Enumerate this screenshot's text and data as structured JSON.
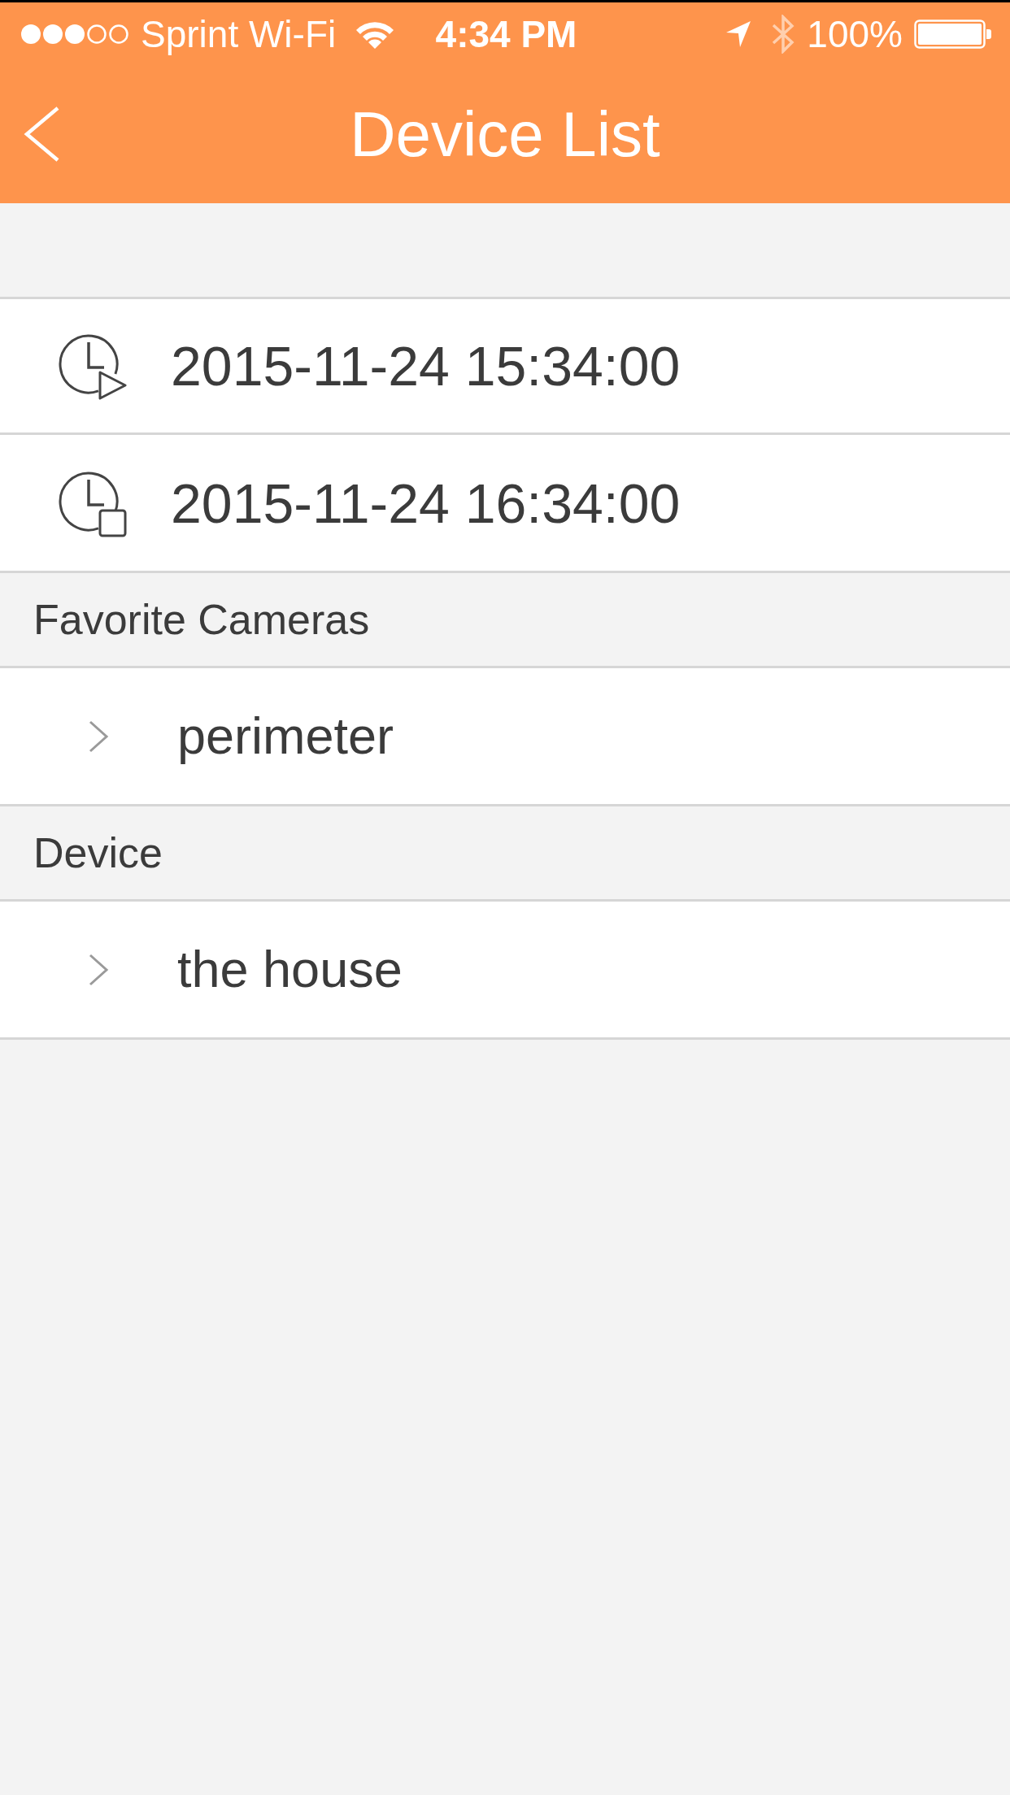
{
  "status_bar": {
    "carrier": "Sprint Wi-Fi",
    "time": "4:34 PM",
    "battery": "100%"
  },
  "nav_bar": {
    "title": "Device List"
  },
  "time_range": [
    {
      "kind": "start",
      "value": "2015-11-24 15:34:00"
    },
    {
      "kind": "end",
      "value": "2015-11-24 16:34:00"
    }
  ],
  "sections": [
    {
      "header": "Favorite Cameras",
      "items": [
        {
          "label": "perimeter",
          "expanded": false
        }
      ]
    },
    {
      "header": "Device",
      "items": [
        {
          "label": "the house",
          "expanded": false
        }
      ]
    }
  ]
}
